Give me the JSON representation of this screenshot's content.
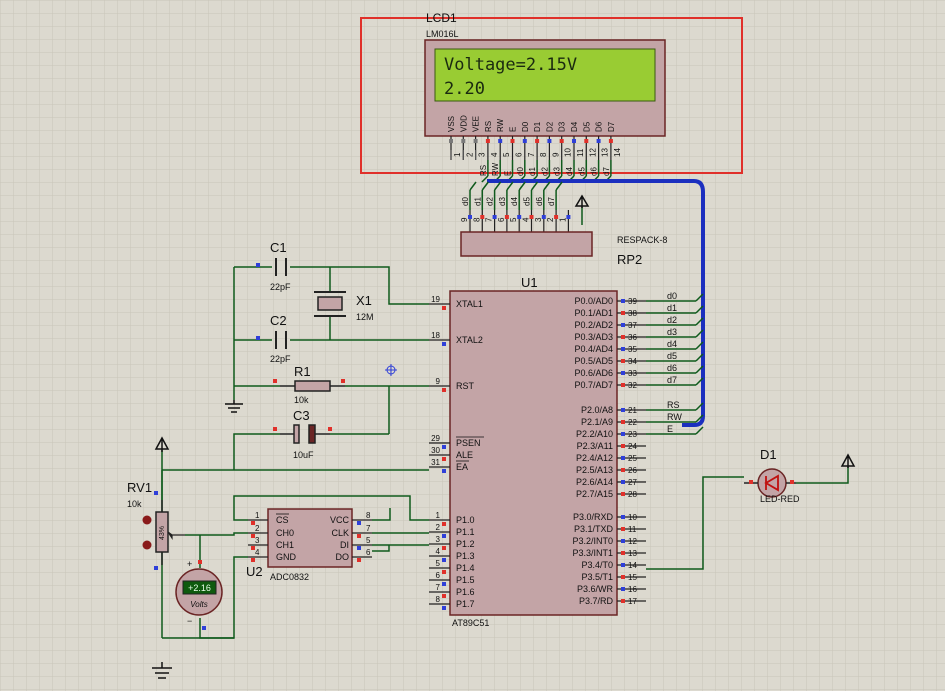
{
  "colors": {
    "background": "#dcd9cf",
    "grid": "#c9c5b9",
    "wire": "#0f5a1c",
    "body_fill": "#c3a4a6",
    "body_stroke": "#6b2525",
    "bus": "#1b2fbf",
    "lcd_screen": "#99cc33",
    "lcd_text": "#1a2a10",
    "selection": "#e0302a",
    "pin_red": "#e0302a",
    "pin_blue": "#2f3fd8",
    "text": "#111111",
    "led": "#c01010"
  },
  "lcd": {
    "ref": "LCD1",
    "part": "LM016L",
    "line1": "Voltage=2.15V",
    "line2": "2.20",
    "pin_labels": [
      "VSS",
      "VDD",
      "VEE",
      "RS",
      "RW",
      "E",
      "D0",
      "D1",
      "D2",
      "D3",
      "D4",
      "D5",
      "D6",
      "D7"
    ],
    "pin_numbers": [
      "1",
      "2",
      "3",
      "4",
      "5",
      "6",
      "7",
      "8",
      "9",
      "10",
      "11",
      "12",
      "13",
      "14"
    ],
    "wire_labels": [
      "RS",
      "RW",
      "E",
      "d0",
      "d1",
      "d2",
      "d3",
      "d4",
      "d5",
      "d6",
      "d7"
    ]
  },
  "respack": {
    "ref": "RP2",
    "part": "RESPACK-8",
    "pin_numbers": [
      "9",
      "8",
      "7",
      "6",
      "5",
      "4",
      "3",
      "2",
      "1"
    ],
    "net_labels": [
      "d0",
      "d1",
      "d2",
      "d3",
      "d4",
      "d5",
      "d6",
      "d7"
    ]
  },
  "mcu": {
    "ref": "U1",
    "part": "AT89C51",
    "left_pins": [
      {
        "num": "19",
        "name": "XTAL1"
      },
      {
        "num": "18",
        "name": "XTAL2"
      },
      {
        "num": "9",
        "name": "RST"
      },
      {
        "num": "29",
        "name": "PSEN"
      },
      {
        "num": "30",
        "name": "ALE"
      },
      {
        "num": "31",
        "name": "EA"
      },
      {
        "num": "1",
        "name": "P1.0"
      },
      {
        "num": "2",
        "name": "P1.1"
      },
      {
        "num": "3",
        "name": "P1.2"
      },
      {
        "num": "4",
        "name": "P1.3"
      },
      {
        "num": "5",
        "name": "P1.4"
      },
      {
        "num": "6",
        "name": "P1.5"
      },
      {
        "num": "7",
        "name": "P1.6"
      },
      {
        "num": "8",
        "name": "P1.7"
      }
    ],
    "right_pins": [
      {
        "num": "39",
        "name": "P0.0/AD0",
        "net": "d0"
      },
      {
        "num": "38",
        "name": "P0.1/AD1",
        "net": "d1"
      },
      {
        "num": "37",
        "name": "P0.2/AD2",
        "net": "d2"
      },
      {
        "num": "36",
        "name": "P0.3/AD3",
        "net": "d3"
      },
      {
        "num": "35",
        "name": "P0.4/AD4",
        "net": "d4"
      },
      {
        "num": "34",
        "name": "P0.5/AD5",
        "net": "d5"
      },
      {
        "num": "33",
        "name": "P0.6/AD6",
        "net": "d6"
      },
      {
        "num": "32",
        "name": "P0.7/AD7",
        "net": "d7"
      },
      {
        "num": "21",
        "name": "P2.0/A8",
        "net": "RS"
      },
      {
        "num": "22",
        "name": "P2.1/A9",
        "net": "RW"
      },
      {
        "num": "23",
        "name": "P2.2/A10",
        "net": "E"
      },
      {
        "num": "24",
        "name": "P2.3/A11",
        "net": ""
      },
      {
        "num": "25",
        "name": "P2.4/A12",
        "net": ""
      },
      {
        "num": "26",
        "name": "P2.5/A13",
        "net": ""
      },
      {
        "num": "27",
        "name": "P2.6/A14",
        "net": ""
      },
      {
        "num": "28",
        "name": "P2.7/A15",
        "net": ""
      },
      {
        "num": "10",
        "name": "P3.0/RXD",
        "net": ""
      },
      {
        "num": "11",
        "name": "P3.1/TXD",
        "net": ""
      },
      {
        "num": "12",
        "name": "P3.2/INT0",
        "net": ""
      },
      {
        "num": "13",
        "name": "P3.3/INT1",
        "net": ""
      },
      {
        "num": "14",
        "name": "P3.4/T0",
        "net": ""
      },
      {
        "num": "15",
        "name": "P3.5/T1",
        "net": ""
      },
      {
        "num": "16",
        "name": "P3.6/WR",
        "net": ""
      },
      {
        "num": "17",
        "name": "P3.7/RD",
        "net": ""
      }
    ]
  },
  "crystal": {
    "ref": "X1",
    "value": "12M"
  },
  "c1": {
    "ref": "C1",
    "value": "22pF"
  },
  "c2": {
    "ref": "C2",
    "value": "22pF"
  },
  "c3": {
    "ref": "C3",
    "value": "10uF"
  },
  "r1": {
    "ref": "R1",
    "value": "10k"
  },
  "rv1": {
    "ref": "RV1",
    "value": "10k",
    "percent": "43%"
  },
  "adc": {
    "ref": "U2",
    "part": "ADC0832",
    "left_pins": [
      {
        "num": "1",
        "name": "CS"
      },
      {
        "num": "2",
        "name": "CH0"
      },
      {
        "num": "3",
        "name": "CH1"
      },
      {
        "num": "4",
        "name": "GND"
      }
    ],
    "right_pins": [
      {
        "num": "8",
        "name": "VCC"
      },
      {
        "num": "7",
        "name": "CLK"
      },
      {
        "num": "5",
        "name": "DI"
      },
      {
        "num": "6",
        "name": "DO"
      }
    ]
  },
  "voltmeter": {
    "reading": "+2.16",
    "unit": "Volts",
    "plus": "+",
    "minus": "−"
  },
  "led": {
    "ref": "D1",
    "part": "LED-RED"
  }
}
